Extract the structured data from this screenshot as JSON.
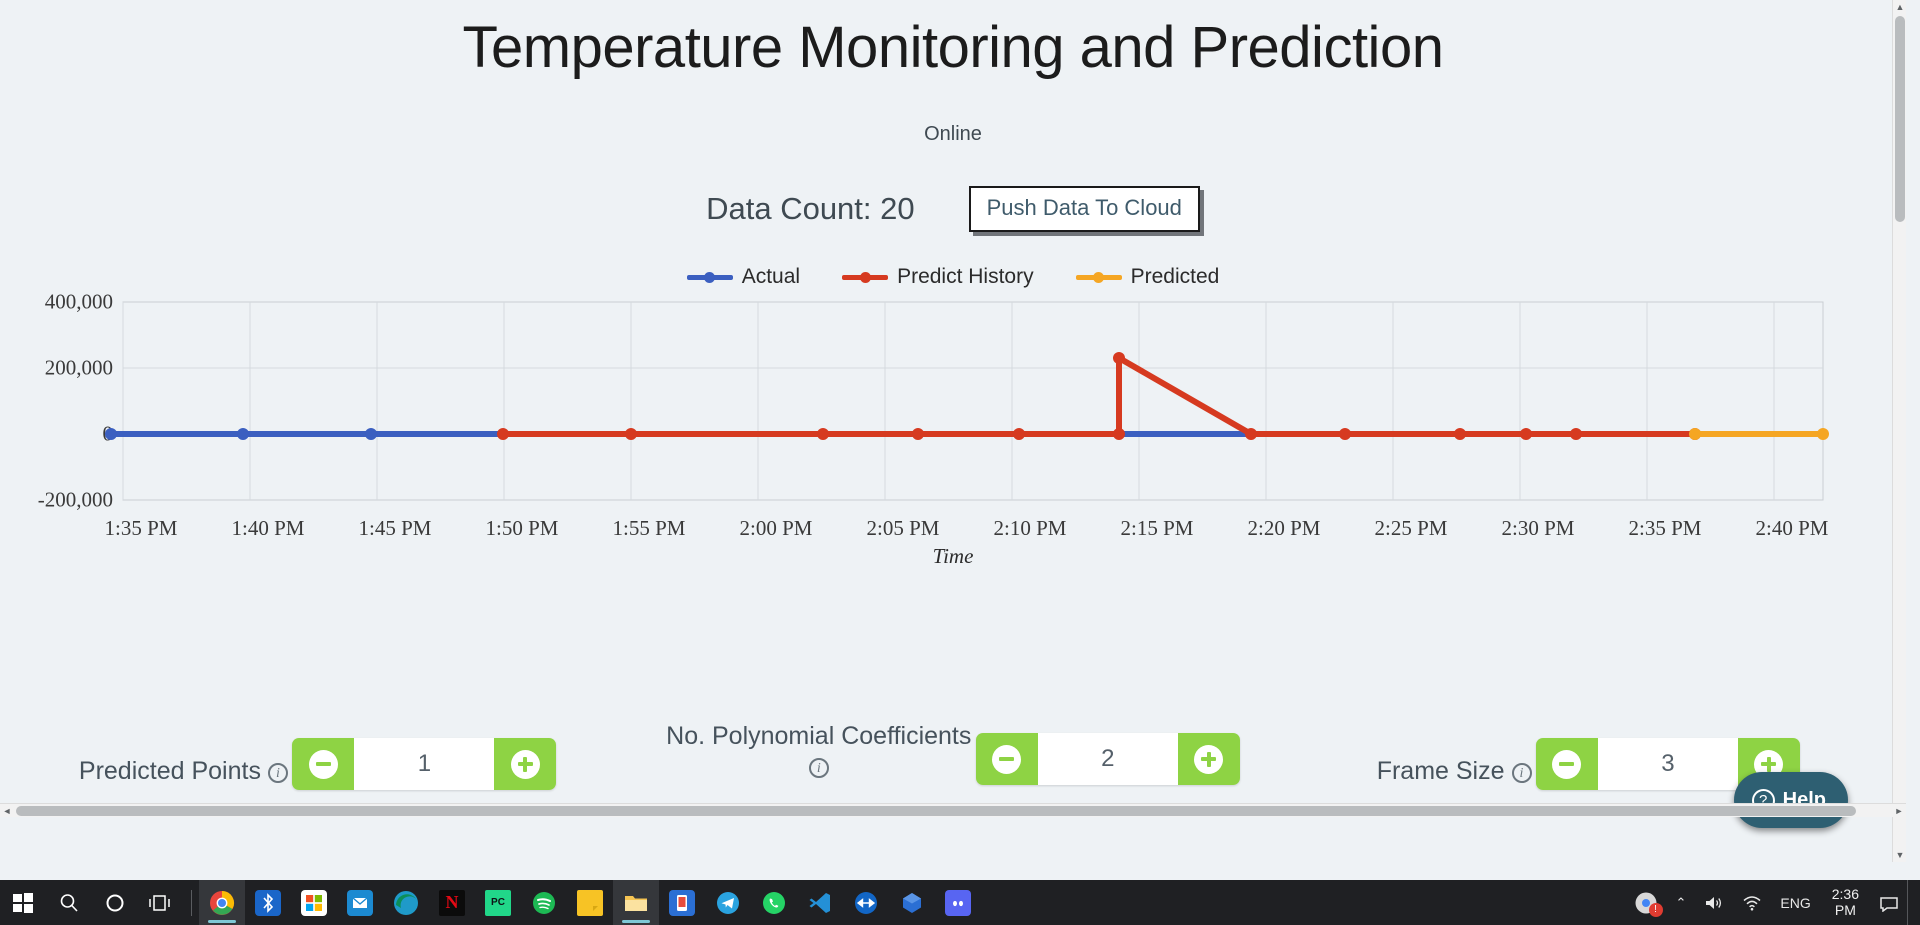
{
  "page": {
    "title": "Temperature Monitoring and Prediction",
    "status": "Online",
    "data_count_label": "Data Count: 20",
    "push_button": "Push Data To Cloud"
  },
  "colors": {
    "background": "#eef2f5",
    "actual": "#3b5fc0",
    "predict_history": "#d63a20",
    "predicted": "#f5a623",
    "stepper_green": "#8ed344",
    "help_teal": "#2e5f72"
  },
  "chart_data": {
    "type": "line",
    "title": "",
    "xlabel": "Time",
    "ylabel": "",
    "grid": true,
    "legend_position": "top-center",
    "ylim": [
      -200000,
      400000
    ],
    "yticks": [
      "400,000",
      "200,000",
      "0",
      "-200,000"
    ],
    "ytick_values": [
      400000,
      200000,
      0,
      -200000
    ],
    "xticks": [
      "1:35 PM",
      "1:40 PM",
      "1:45 PM",
      "1:50 PM",
      "1:55 PM",
      "2:00 PM",
      "2:05 PM",
      "2:10 PM",
      "2:15 PM",
      "2:20 PM",
      "2:25 PM",
      "2:30 PM",
      "2:35 PM",
      "2:40 PM"
    ],
    "series": [
      {
        "name": "Actual",
        "color": "#3b5fc0",
        "x": [
          "1:35 PM",
          "1:40 PM",
          "1:45 PM",
          "1:50 PM",
          "2:14 PM",
          "2:19 PM"
        ],
        "values": [
          0,
          0,
          0,
          0,
          0,
          0
        ],
        "marker_x": [
          "1:35 PM",
          "1:40 PM",
          "1:45 PM"
        ]
      },
      {
        "name": "Predict History",
        "color": "#d63a20",
        "x": [
          "1:49 PM",
          "1:54 PM",
          "2:05 PM",
          "2:09 PM",
          "2:12 PM",
          "2:14 PM",
          "2:14 PM",
          "2:19 PM",
          "2:23 PM",
          "2:28 PM",
          "2:30 PM",
          "2:32 PM",
          "2:36 PM"
        ],
        "values": [
          0,
          0,
          0,
          0,
          0,
          0,
          210000,
          0,
          0,
          0,
          0,
          0,
          0
        ]
      },
      {
        "name": "Predicted",
        "color": "#f5a623",
        "x": [
          "2:36 PM",
          "2:41 PM"
        ],
        "values": [
          0,
          0
        ]
      }
    ]
  },
  "legend": [
    {
      "label": "Actual",
      "color": "#3b5fc0"
    },
    {
      "label": "Predict History",
      "color": "#d63a20"
    },
    {
      "label": "Predicted",
      "color": "#f5a623"
    }
  ],
  "controls": [
    {
      "label": "Predicted Points",
      "value": "1",
      "info": "i",
      "decrement": "−",
      "increment": "+",
      "label_wraps": false
    },
    {
      "label": "No. Polynomial Coefficients",
      "value": "2",
      "info": "i",
      "decrement": "−",
      "increment": "+",
      "label_wraps": true
    },
    {
      "label": "Frame Size",
      "value": "3",
      "info": "i",
      "decrement": "−",
      "increment": "+",
      "label_wraps": false
    }
  ],
  "help": {
    "label": "Help",
    "icon": "?"
  },
  "taskbar": {
    "start": "⊞",
    "search": "search-icon",
    "cortana": "circle-icon",
    "taskview": "taskview-icon",
    "apps": [
      {
        "name": "chrome",
        "glyph": "",
        "bg": "#ffffff",
        "active": true
      },
      {
        "name": "bluetooth-app",
        "glyph": "",
        "bg": "#1a66c9",
        "active": false
      },
      {
        "name": "microsoft-store",
        "glyph": "",
        "bg": "#ffffff",
        "active": false
      },
      {
        "name": "outlook",
        "glyph": "",
        "bg": "#1c8ad1",
        "active": false
      },
      {
        "name": "edge",
        "glyph": "",
        "bg": "#1f9ac9",
        "active": false
      },
      {
        "name": "netflix",
        "glyph": "N",
        "bg": "#0b0b0b",
        "active": false
      },
      {
        "name": "pycharm",
        "glyph": "PC",
        "bg": "#21d789",
        "active": false
      },
      {
        "name": "spotify",
        "glyph": "",
        "bg": "#1db954",
        "active": false
      },
      {
        "name": "sticky-notes",
        "glyph": "",
        "bg": "#f7c325",
        "active": false
      },
      {
        "name": "file-explorer",
        "glyph": "",
        "bg": "#f5c453",
        "active": true
      },
      {
        "name": "anydesk",
        "glyph": "",
        "bg": "#2b6fd4",
        "active": false
      },
      {
        "name": "telegram",
        "glyph": "",
        "bg": "#2aa3e0",
        "active": false
      },
      {
        "name": "whatsapp",
        "glyph": "",
        "bg": "#25d366",
        "active": false
      },
      {
        "name": "vs-code",
        "glyph": "",
        "bg": "#1f8ad4",
        "active": false
      },
      {
        "name": "teamviewer",
        "glyph": "",
        "bg": "#1266c6",
        "active": false
      },
      {
        "name": "blender",
        "glyph": "",
        "bg": "#2b6fd4",
        "active": false
      },
      {
        "name": "discord",
        "glyph": "",
        "bg": "#5865f2",
        "active": false
      }
    ],
    "tray": {
      "notification_badge": "!",
      "chevron": "⌃",
      "volume": "volume-icon",
      "network": "wifi-icon",
      "language": "ENG",
      "time": "2:36",
      "ampm": "PM",
      "action_center": "action-center-icon"
    }
  },
  "scrollbars": {
    "vertical_up": "▲",
    "vertical_down": "▼",
    "horizontal_left": "◄",
    "horizontal_right": "►"
  }
}
